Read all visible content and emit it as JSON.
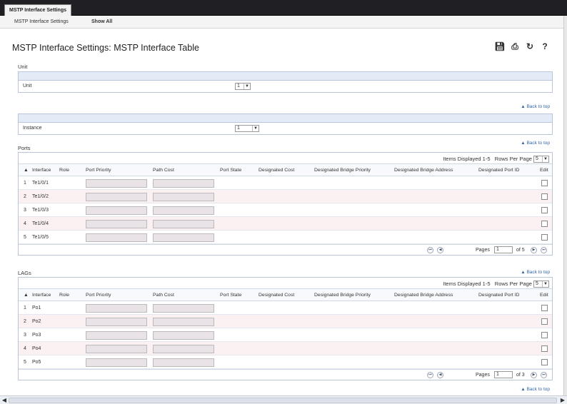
{
  "top_tab": "MSTP Interface Settings",
  "subnav": [
    "MSTP Interface Settings",
    "Show All"
  ],
  "page_title": "MSTP Interface Settings: MSTP Interface Table",
  "unit_section": {
    "title": "Unit",
    "label": "Unit",
    "value": "1"
  },
  "instance_section": {
    "label": "Instance",
    "value": "1"
  },
  "back_to_top": "Back to top",
  "ports": {
    "title": "Ports",
    "items_displayed": "Items Displayed 1-5",
    "rows_per_page_label": "Rows Per Page",
    "rows_per_page": "5",
    "headers": [
      "Interface",
      "Role",
      "Port Priority",
      "Path Cost",
      "Port State",
      "Designated Cost",
      "Designated Bridge Priority",
      "Designated Bridge Address",
      "Designated Port ID",
      "Edit"
    ],
    "rows": [
      {
        "num": "1",
        "iface": "Te1/0/1"
      },
      {
        "num": "2",
        "iface": "Te1/0/2"
      },
      {
        "num": "3",
        "iface": "Te1/0/3"
      },
      {
        "num": "4",
        "iface": "Te1/0/4"
      },
      {
        "num": "5",
        "iface": "Te1/0/5"
      }
    ],
    "pages_label": "Pages",
    "page": "1",
    "of_label": "of 5"
  },
  "lags": {
    "title": "LAGs",
    "items_displayed": "Items Displayed 1-5",
    "rows_per_page_label": "Rows Per Page",
    "rows_per_page": "5",
    "headers": [
      "Interface",
      "Role",
      "Port Priority",
      "Path Cost",
      "Port State",
      "Designated Cost",
      "Designated Bridge Priority",
      "Designated Bridge Address",
      "Designated Port ID",
      "Edit"
    ],
    "rows": [
      {
        "num": "1",
        "iface": "Po1"
      },
      {
        "num": "2",
        "iface": "Po2"
      },
      {
        "num": "3",
        "iface": "Po3"
      },
      {
        "num": "4",
        "iface": "Po4"
      },
      {
        "num": "5",
        "iface": "Po5"
      }
    ],
    "pages_label": "Pages",
    "page": "1",
    "of_label": "of 3"
  },
  "icons": [
    "save-icon",
    "print-icon",
    "refresh-icon",
    "help-icon"
  ]
}
